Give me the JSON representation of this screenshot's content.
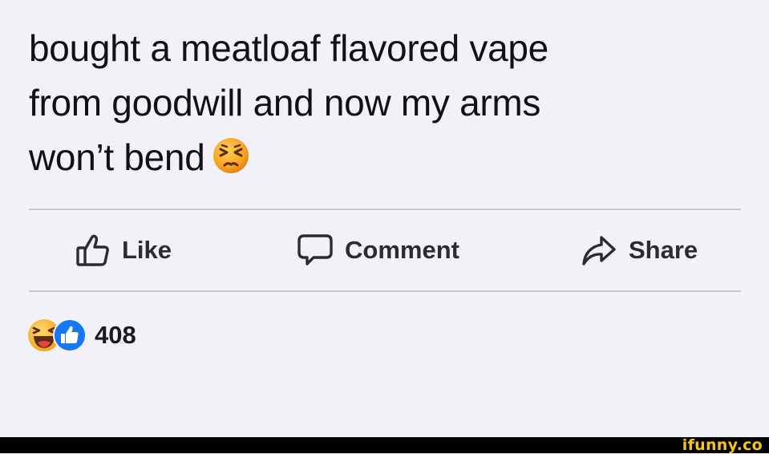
{
  "post": {
    "text_lines": [
      "bought a meatloaf flavored vape",
      "from goodwill and now my arms",
      "won’t bend"
    ],
    "emoji": "persevering-face-emoji"
  },
  "actions": {
    "like_label": "Like",
    "comment_label": "Comment",
    "share_label": "Share"
  },
  "reactions": {
    "icons": [
      "laughing-face-icon",
      "like-thumb-icon"
    ],
    "count": "408"
  },
  "watermark": "ifunny.co",
  "colors": {
    "background": "#f2f1f7",
    "like_blue": "#1877f2",
    "emoji_yellow": "#f7b731",
    "watermark_yellow": "#f5c518"
  }
}
